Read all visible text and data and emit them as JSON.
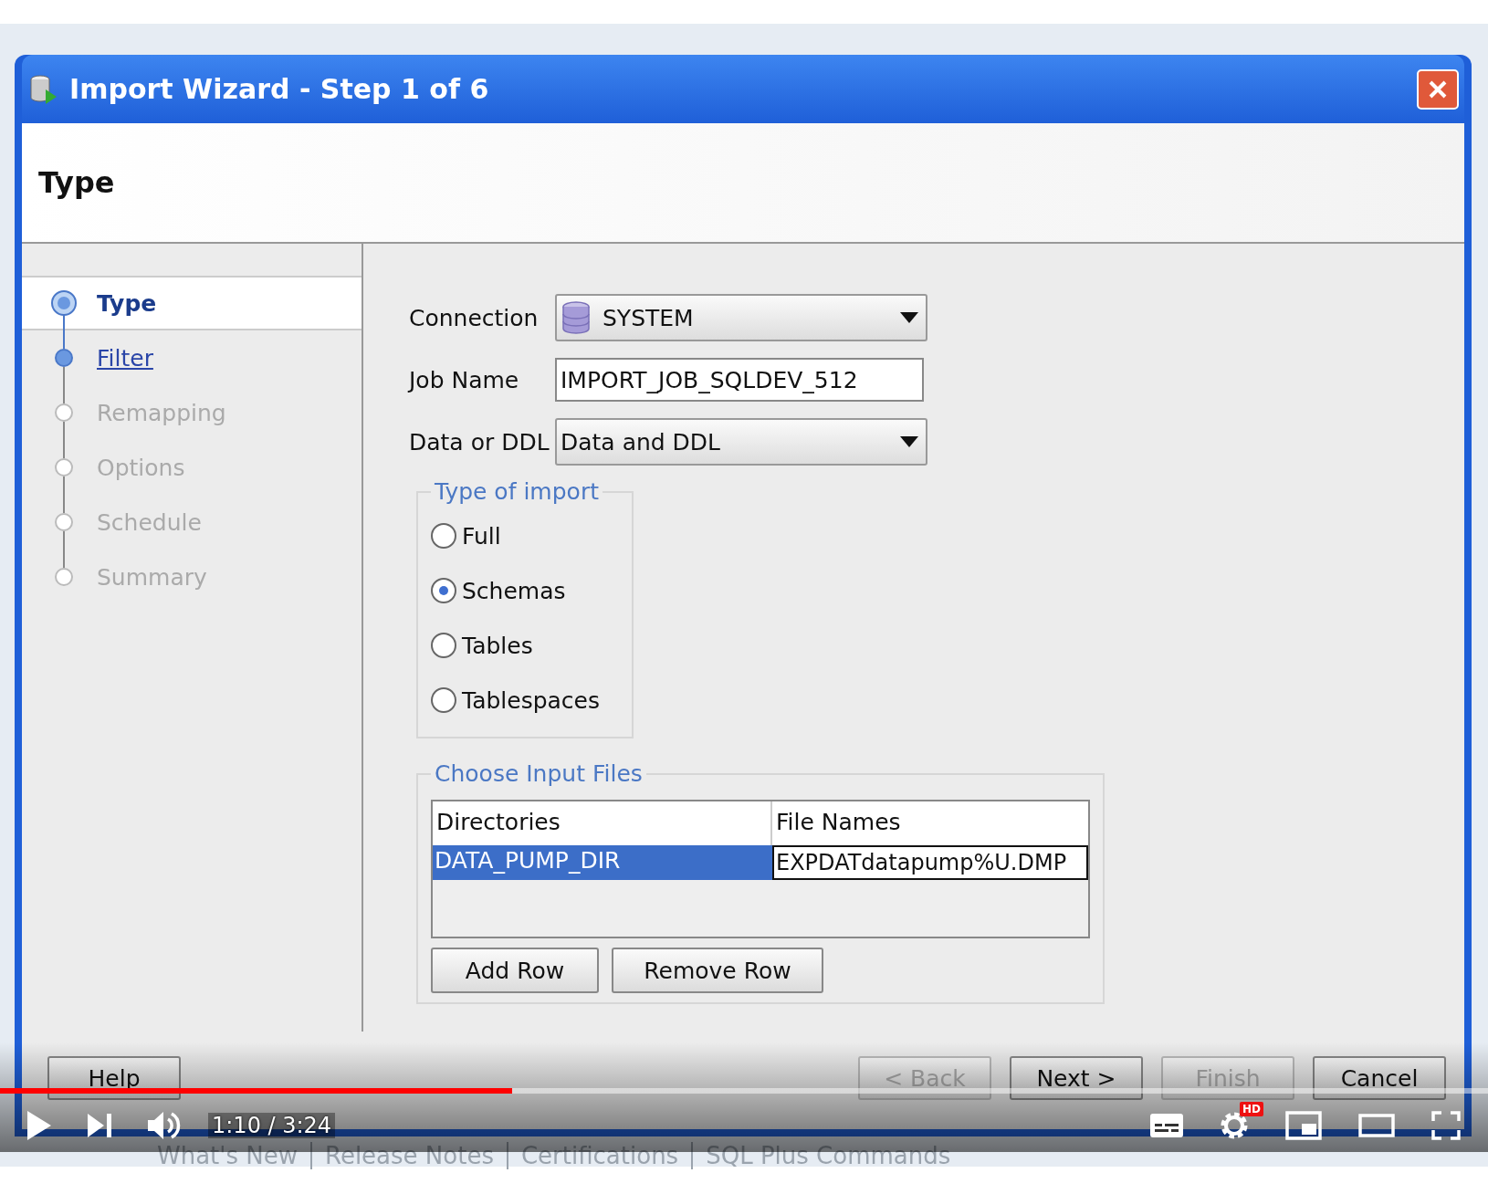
{
  "dialog": {
    "title": "Import Wizard - Step 1 of 6",
    "header": "Type",
    "steps": [
      {
        "label": "Type",
        "selected": true,
        "disabled": false
      },
      {
        "label": "Filter",
        "selected": false,
        "disabled": false
      },
      {
        "label": "Remapping",
        "selected": false,
        "disabled": true
      },
      {
        "label": "Options",
        "selected": false,
        "disabled": true
      },
      {
        "label": "Schedule",
        "selected": false,
        "disabled": true
      },
      {
        "label": "Summary",
        "selected": false,
        "disabled": true
      }
    ],
    "fields": [
      {
        "kind": "connection",
        "label": "Connection",
        "value": "SYSTEM"
      },
      {
        "kind": "text",
        "label": "Job Name",
        "value": "IMPORT_JOB_SQLDEV_512"
      },
      {
        "kind": "dropdown",
        "label": "Data or DDL",
        "value": "Data and DDL"
      }
    ],
    "type_of_import": {
      "title": "Type of import",
      "options": [
        {
          "label": "Full",
          "selected": false
        },
        {
          "label": "Schemas",
          "selected": true
        },
        {
          "label": "Tables",
          "selected": false
        },
        {
          "label": "Tablespaces",
          "selected": false
        }
      ]
    },
    "input_files": {
      "title": "Choose Input Files",
      "columns": [
        "Directories",
        "File Names"
      ],
      "rows": [
        {
          "directory": "DATA_PUMP_DIR",
          "file_name": "EXPDATdatapump%U.DMP",
          "selected": true
        }
      ],
      "buttons": [
        "Add Row",
        "Remove Row"
      ]
    },
    "help_button": "Help",
    "buttons": [
      {
        "label": "< Back",
        "disabled": true
      },
      {
        "label": "Next >",
        "disabled": false
      },
      {
        "label": "Finish",
        "disabled": true
      },
      {
        "label": "Cancel",
        "disabled": false
      }
    ]
  },
  "background_links": [
    "What's New",
    "Release Notes",
    "Certifications",
    "SQL Plus Commands"
  ],
  "video_player": {
    "progress": {
      "level": 0.344
    },
    "time": "1:10 / 3:24",
    "hd_badge": "HD"
  }
}
